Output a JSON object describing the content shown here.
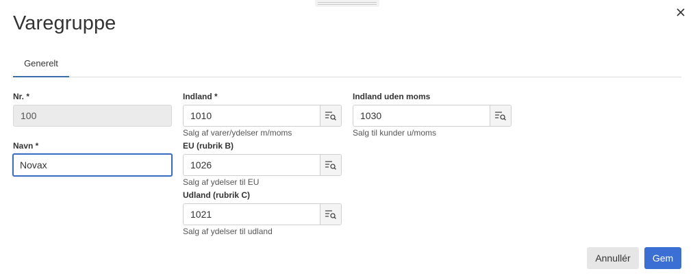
{
  "dialog": {
    "title": "Varegruppe",
    "close_icon": "close-icon"
  },
  "tabs": [
    {
      "label": "Generelt",
      "active": true
    }
  ],
  "fields": {
    "nr": {
      "label": "Nr. *",
      "value": "100",
      "disabled": true
    },
    "navn": {
      "label": "Navn *",
      "value": "Novax",
      "focused": true
    },
    "indland": {
      "label": "Indland *",
      "value": "1010",
      "hint": "Salg af varer/ydelser m/moms",
      "icon": "lookup-list-icon"
    },
    "eu": {
      "label": "EU (rubrik B)",
      "value": "1026",
      "hint": "Salg af ydelser til EU",
      "icon": "lookup-list-icon"
    },
    "udland": {
      "label": "Udland (rubrik C)",
      "value": "1021",
      "hint": "Salg af ydelser til udland",
      "icon": "lookup-list-icon"
    },
    "indland_uden_moms": {
      "label": "Indland uden moms",
      "value": "1030",
      "hint": "Salg til kunder u/moms",
      "icon": "lookup-list-icon"
    }
  },
  "footer": {
    "cancel_label": "Annullér",
    "save_label": "Gem"
  },
  "colors": {
    "primary": "#3b6fd4",
    "focus_border": "#3b6fc2",
    "tab_underline": "#3a6ea5"
  }
}
